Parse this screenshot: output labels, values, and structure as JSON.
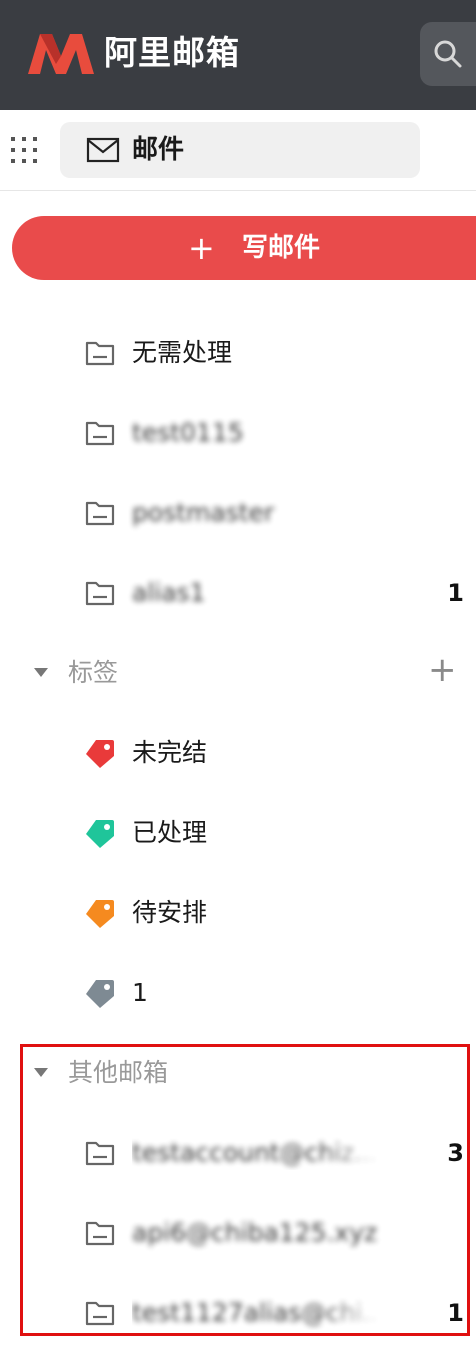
{
  "header": {
    "brand": "阿里邮箱",
    "brand_color": "#e84c3d",
    "search_icon": "search-icon"
  },
  "app_switcher": {
    "grid_icon": "grid-icon",
    "current_app": "邮件",
    "current_app_icon": "mail-icon"
  },
  "compose": {
    "plus": "+",
    "label": "写邮件"
  },
  "folders": [
    {
      "label": "无需处理",
      "count": ""
    },
    {
      "label": "test0115",
      "count": "",
      "obscured": true
    },
    {
      "label": "postmaster",
      "count": "",
      "obscured": true
    },
    {
      "label": "alias1",
      "count": "1",
      "obscured": true
    }
  ],
  "tags_section": {
    "title": "标签",
    "add": "+",
    "items": [
      {
        "label": "未完结",
        "color": "#e93a3a"
      },
      {
        "label": "已处理",
        "color": "#1fc59a"
      },
      {
        "label": "待安排",
        "color": "#f58a1f"
      },
      {
        "label": "1",
        "color": "#7e8a93"
      }
    ]
  },
  "other_mailboxes": {
    "title": "其他邮箱",
    "items": [
      {
        "label": "testaccount@chiz...",
        "count": "3",
        "obscured": true
      },
      {
        "label": "api6@chiba125.xyz",
        "count": "",
        "obscured": true
      },
      {
        "label": "test1127alias@chi...",
        "count": "1",
        "obscured": true
      }
    ]
  }
}
